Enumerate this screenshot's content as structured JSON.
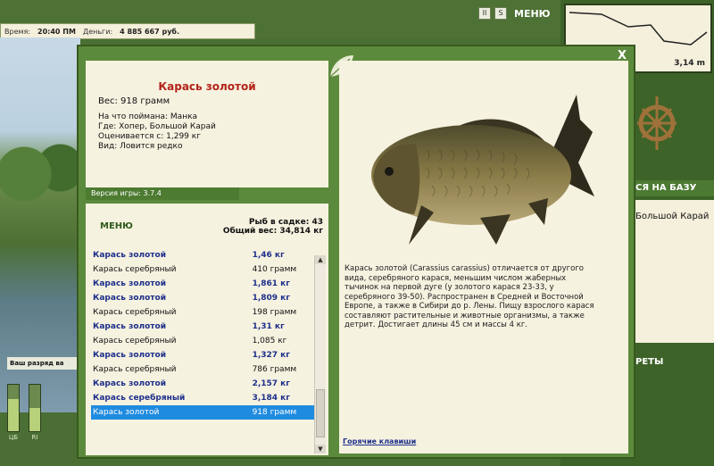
{
  "hud": {
    "time_label": "Время:",
    "time_value": "20:40 ПМ",
    "money_label": "Деньги:",
    "money_value": "4 885 667 руб.",
    "menu_label": "МЕНЮ",
    "icon_pause": "II",
    "icon_sound": "S"
  },
  "right_panel": {
    "depth_value": "3,14 m",
    "to_base_label": "СЯ НА БАЗУ",
    "location_text": "Большой Карай",
    "secrets_label": "РЕТЫ"
  },
  "background": {
    "rank_tip": "Ваш разряд ва",
    "gauge1_label": "ЦБ",
    "gauge2_label": "RI",
    "gauge1_level": 0.7,
    "gauge2_level": 0.5
  },
  "dialog": {
    "close_label": "X",
    "fish_name": "Карась золотой",
    "weight": "Вес: 918 грамм",
    "caught_on": "На что поймана: Манка",
    "where": "Где: Хопер, Большой Карай",
    "valued_from": "Оценивается с: 1,299 кг",
    "kind": "Вид: Ловится редко",
    "version": "Версия игры: 3.7.4",
    "menu_label": "МЕНЮ",
    "fish_in_keepnet": "Рыб в садке: 43",
    "total_weight": "Общий вес: 34,814 кг",
    "catch_list": [
      {
        "name": "Карась золотой",
        "weight": "1,46 кг",
        "bold": true
      },
      {
        "name": "Карась серебряный",
        "weight": "410 грамм",
        "bold": false
      },
      {
        "name": "Карась золотой",
        "weight": "1,861 кг",
        "bold": true
      },
      {
        "name": "Карась золотой",
        "weight": "1,809 кг",
        "bold": true
      },
      {
        "name": "Карась серебряный",
        "weight": "198 грамм",
        "bold": false
      },
      {
        "name": "Карась золотой",
        "weight": "1,31 кг",
        "bold": true
      },
      {
        "name": "Карась серебряный",
        "weight": "1,085 кг",
        "bold": false
      },
      {
        "name": "Карась золотой",
        "weight": "1,327 кг",
        "bold": true
      },
      {
        "name": "Карась серебряный",
        "weight": "786 грамм",
        "bold": false
      },
      {
        "name": "Карась золотой",
        "weight": "2,157 кг",
        "bold": true
      },
      {
        "name": "Карась серебряный",
        "weight": "3,184 кг",
        "bold": true
      },
      {
        "name": "Карась золотой",
        "weight": "918 грамм",
        "bold": false,
        "selected": true
      }
    ],
    "description": "Карась золотой (Carassius carassius) отличается от другого вида, серебряного карася, меньшим числом жаберных тычинок на первой дуге (у золотого карася 23-33, у серебряного 39-50). Распространен в Средней и Восточной Европе, а также в Сибири до р. Лены. Пищу взрослого карася составляют растительные и животные организмы, а также детрит. Достигает длины 45 см и массы 4 кг.",
    "hotkeys_label": "Горячие клавиши"
  },
  "colors": {
    "dialog_bg": "#5c8a3c",
    "panel_bg": "#f6f2e0",
    "title_red": "#b3241a",
    "bold_blue": "#1d2f8a",
    "selection": "#1f8be0"
  }
}
